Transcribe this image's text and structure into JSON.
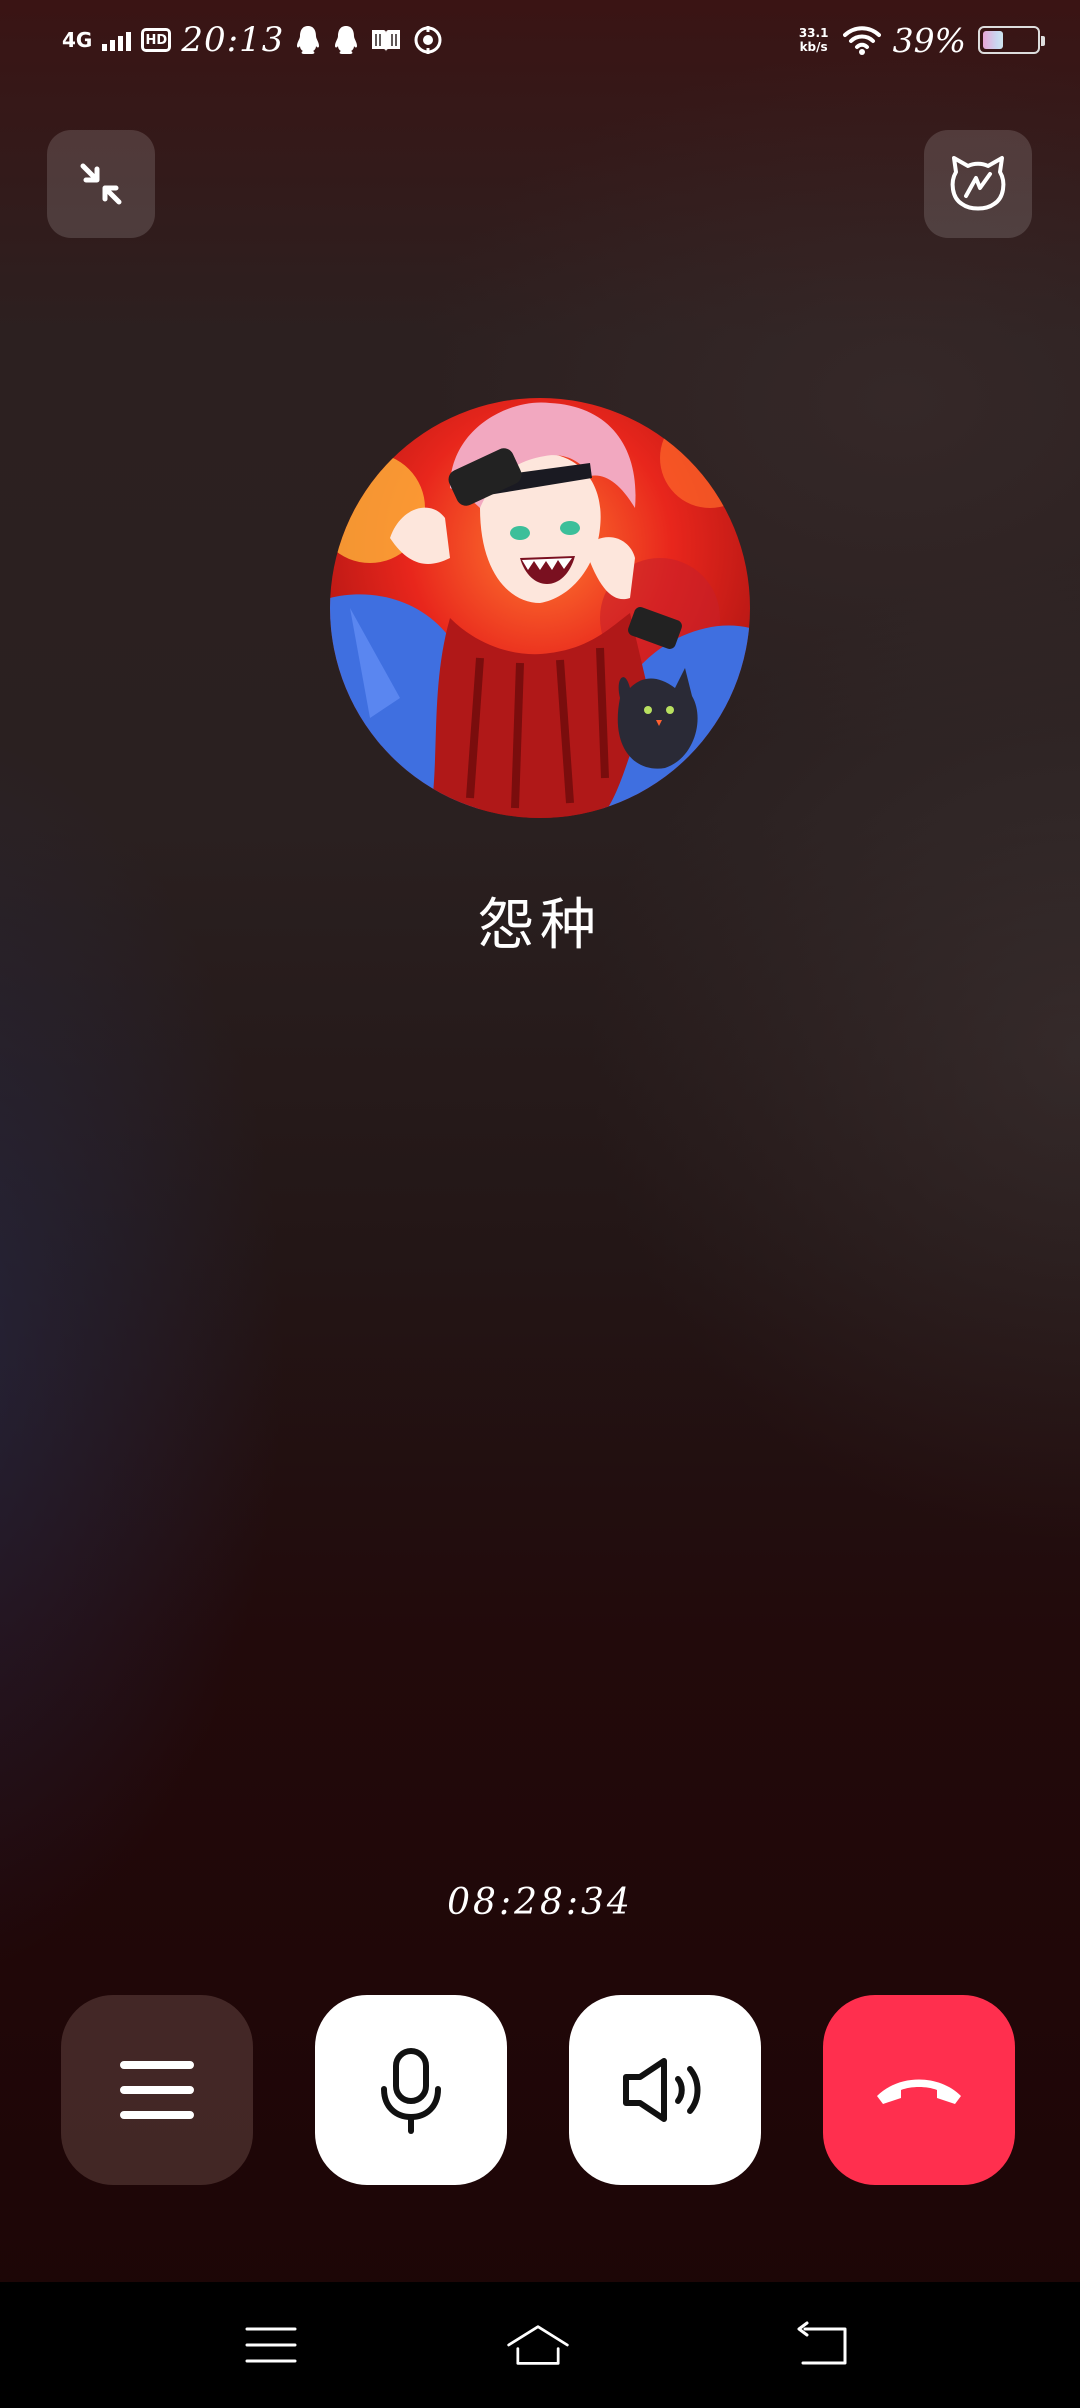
{
  "status_bar": {
    "network_type": "4G",
    "hd_label": "HD",
    "time": "20:13",
    "net_speed_value": "33.1",
    "net_speed_unit": "kb/s",
    "battery_text": "39%",
    "battery_level": 0.39,
    "icons": [
      "qq-icon",
      "qq-icon",
      "book-icon",
      "compass-icon",
      "wifi-icon",
      "battery-icon"
    ]
  },
  "call": {
    "contact_name": "怨种",
    "duration": "08:28:34"
  },
  "top_buttons": {
    "minimize_icon": "minimize-arrows-icon",
    "effects_icon": "cat-face-icon"
  },
  "controls": [
    {
      "name": "menu",
      "icon": "menu-icon"
    },
    {
      "name": "microphone",
      "icon": "microphone-icon"
    },
    {
      "name": "speaker",
      "icon": "speaker-icon"
    },
    {
      "name": "hang-up",
      "icon": "hang-up-icon"
    }
  ],
  "colors": {
    "hangup": "#ff2f4e",
    "control_light": "#ffffff",
    "control_dark": "#5a3c38"
  },
  "nav_bar": {
    "icons": [
      "recent-apps-icon",
      "home-icon",
      "back-icon"
    ]
  }
}
